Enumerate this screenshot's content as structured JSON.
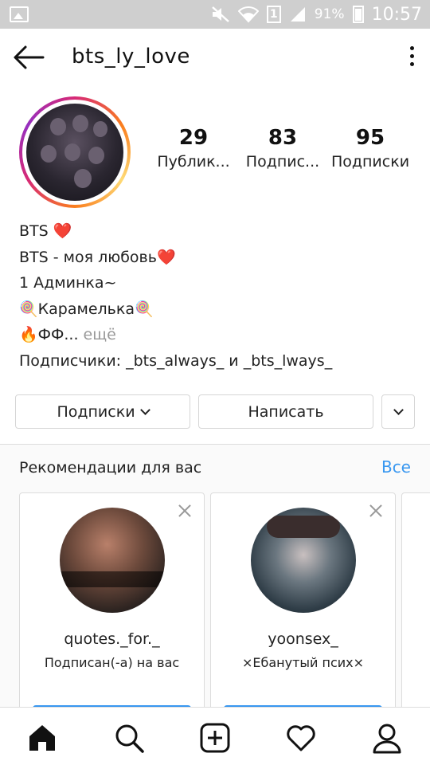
{
  "status_bar": {
    "battery_percent": "91%",
    "sim_number": "1",
    "time": "10:57",
    "icons": [
      "gallery-icon",
      "mute-icon",
      "wifi-icon",
      "sim-icon",
      "signal-icon",
      "battery-icon"
    ]
  },
  "header": {
    "username": "bts_ly_love",
    "icons": [
      "back-arrow-icon",
      "more-vertical-icon"
    ]
  },
  "stats": [
    {
      "value": "29",
      "label": "Публик..."
    },
    {
      "value": "83",
      "label": "Подпис..."
    },
    {
      "value": "95",
      "label": "Подписки"
    }
  ],
  "bio": {
    "line1": "BTS ❤️",
    "line2": "BTS - моя любовь❤️",
    "line3": "1 Админка~",
    "line4": "🍭Карамелька🍭",
    "line5_text": "🔥ФФ...",
    "line5_more": " ещё",
    "line6": "Подписчики: _bts_always_ и _bts_lways_"
  },
  "buttons": {
    "following": "Подписки",
    "message": "Написать"
  },
  "recommendations": {
    "title": "Рекомендации для вас",
    "see_all": "Все",
    "cards": [
      {
        "username": "quotes._for._",
        "subtitle": "Подписан(-а) на вас"
      },
      {
        "username": "yoonsex_",
        "subtitle": "×Ебанутый псих×"
      }
    ]
  },
  "nav": {
    "icons": [
      "home-icon",
      "search-icon",
      "new-post-icon",
      "activity-heart-icon",
      "profile-icon"
    ]
  },
  "colors": {
    "accent": "#3897f0",
    "heart": "#e0102b",
    "status_bar": "#cfcfcf"
  }
}
